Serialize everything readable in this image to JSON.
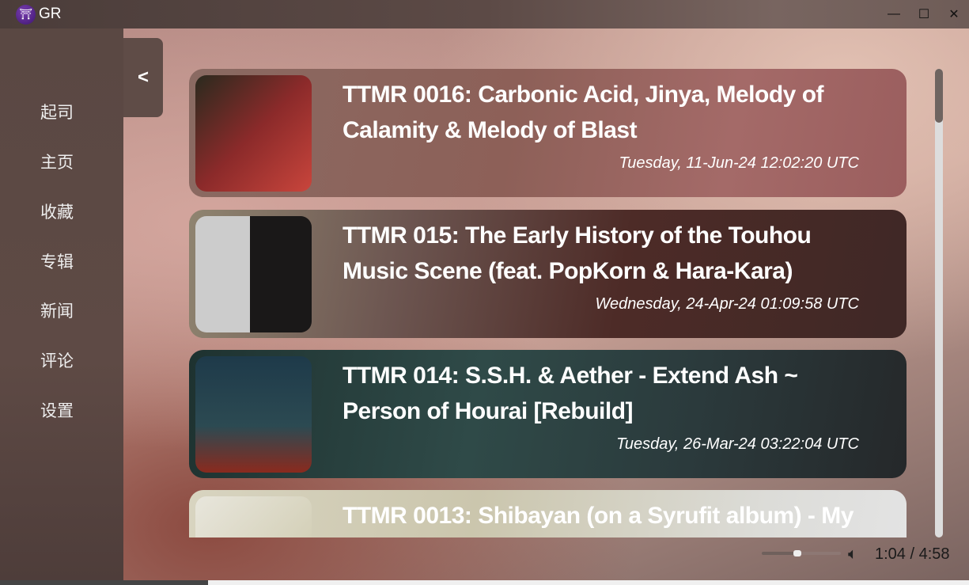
{
  "app": {
    "title": "GR",
    "logo_icon": "torii-gate-icon"
  },
  "window": {
    "minimize": "—",
    "maximize": "☐",
    "close": "✕"
  },
  "sidebar": {
    "items": [
      {
        "label": "起司"
      },
      {
        "label": "主页"
      },
      {
        "label": "收藏"
      },
      {
        "label": "专辑"
      },
      {
        "label": "新闻"
      },
      {
        "label": "评论"
      },
      {
        "label": "设置"
      }
    ]
  },
  "collapse_label": "<",
  "posts": [
    {
      "title": "TTMR 0016: Carbonic Acid, Jinya, Melody of Calamity & Melody of Blast",
      "date": "Tuesday, 11-Jun-24 12:02:20 UTC"
    },
    {
      "title": "TTMR 015: The Early History of the Touhou Music Scene (feat. PopKorn & Hara-Kara)",
      "date": "Wednesday, 24-Apr-24 01:09:58 UTC"
    },
    {
      "title": "TTMR 014: S.S.H. & Aether - Extend Ash ~ Person of Hourai [Rebuild]",
      "date": "Tuesday, 26-Mar-24 03:22:04 UTC"
    },
    {
      "title": "TTMR 0013: Shibayan (on a Syrufit album) - My",
      "date": ""
    }
  ],
  "player": {
    "time": "1:04 / 4:58",
    "volume_percent": 45,
    "progress_percent": 21.5,
    "speaker_icon": "speaker-icon"
  }
}
